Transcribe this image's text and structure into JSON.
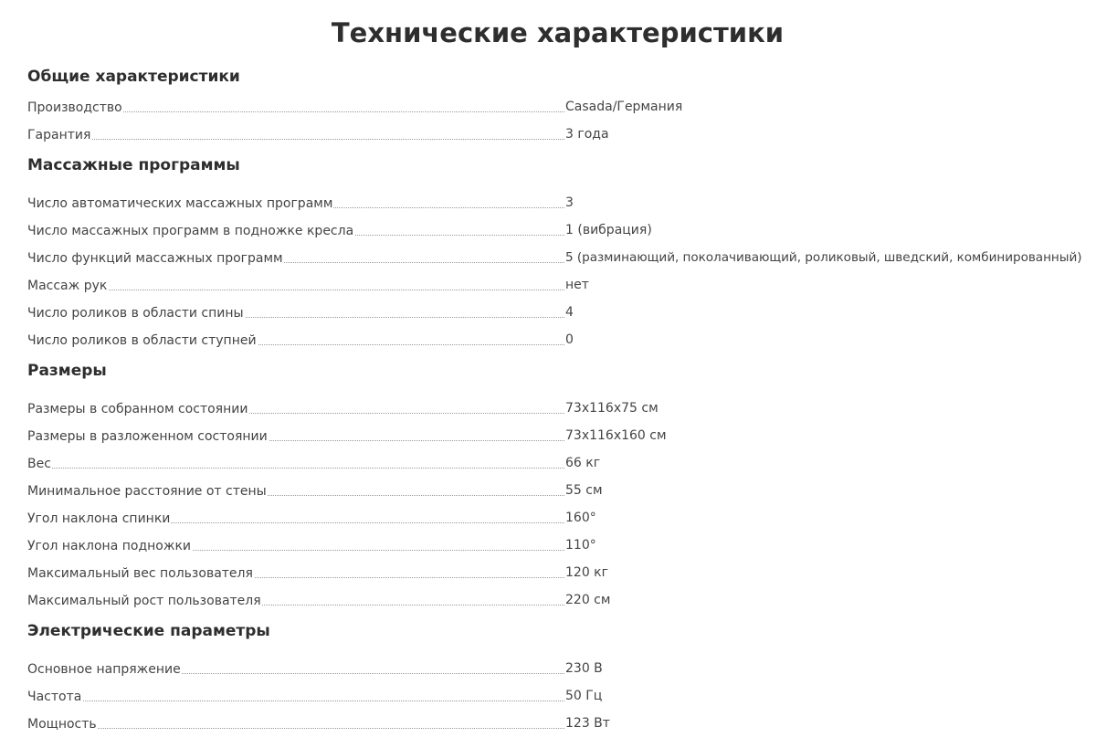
{
  "title": "Технические характеристики",
  "sections": [
    {
      "title": "Общие характеристики",
      "rows": [
        {
          "label": "Производство",
          "value": "Casada/Германия"
        },
        {
          "label": "Гарантия",
          "value": "3 года"
        }
      ]
    },
    {
      "title": "Массажные программы",
      "rows": [
        {
          "label": "Число автоматических массажных программ",
          "value": "3"
        },
        {
          "label": "Число массажных программ в подножке кресла",
          "value": "1 (вибрация)"
        },
        {
          "label": "Число функций массажных программ",
          "value": "5 (разминающий, поколачивающий, роликовый, шведский, комбинированный)"
        },
        {
          "label": "Массаж рук",
          "value": "нет"
        },
        {
          "label": "Число роликов в области спины",
          "value": "4"
        },
        {
          "label": "Число роликов в области ступней",
          "value": "0"
        }
      ]
    },
    {
      "title": "Размеры",
      "rows": [
        {
          "label": "Размеры в собранном состоянии",
          "value": "73х116х75 см"
        },
        {
          "label": "Размеры в разложенном состоянии",
          "value": "73х116х160 см"
        },
        {
          "label": "Вес",
          "value": "66 кг"
        },
        {
          "label": "Минимальное расстояние от стены",
          "value": "55 см"
        },
        {
          "label": "Угол наклона спинки",
          "value": "160°"
        },
        {
          "label": "Угол наклона подножки",
          "value": "110°"
        },
        {
          "label": "Максимальный вес пользователя",
          "value": "120 кг"
        },
        {
          "label": "Максимальный рост пользователя",
          "value": "220 см"
        }
      ]
    },
    {
      "title": "Электрические параметры",
      "rows": [
        {
          "label": "Основное напряжение",
          "value": "230 В"
        },
        {
          "label": "Частота",
          "value": "50 Гц"
        },
        {
          "label": "Мощность",
          "value": "123 Вт"
        }
      ]
    }
  ]
}
